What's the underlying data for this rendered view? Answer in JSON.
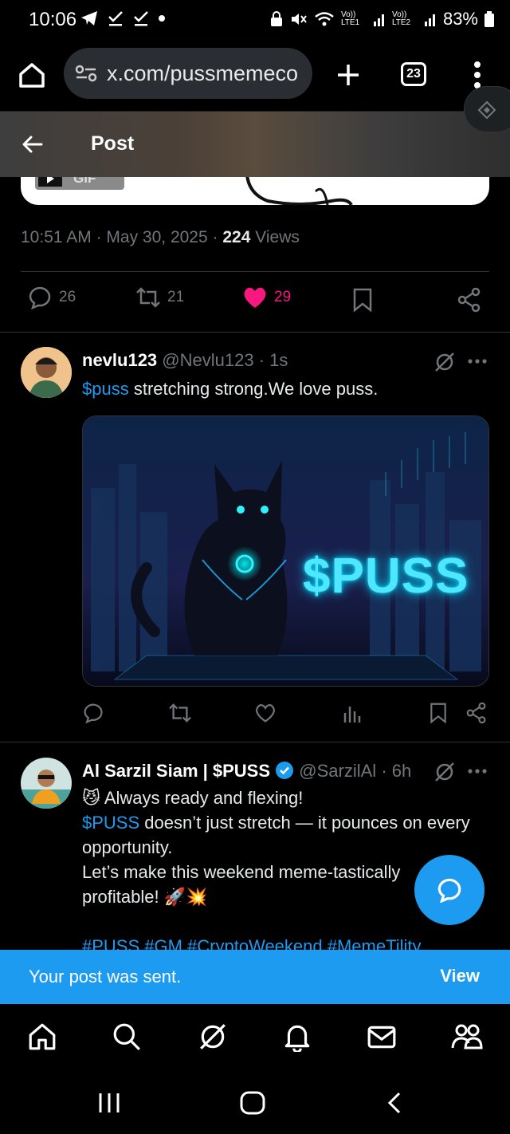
{
  "status_bar": {
    "time": "10:06",
    "network_1": "Vo)) LTE1",
    "network_2": "Vo)) LTE2",
    "battery": "83%"
  },
  "browser": {
    "url": "x.com/pussmemeco",
    "tab_count": "23"
  },
  "post_header": {
    "title": "Post"
  },
  "main_post": {
    "gif_label": "GIF",
    "time": "10:51 AM",
    "date": "May 30, 2025",
    "views_count": "224",
    "views_label": "Views",
    "replies": "26",
    "reposts": "21",
    "likes": "29",
    "like_color": "#f91880"
  },
  "reply_1": {
    "name": "nevlu123",
    "handle": "@Nevlu123",
    "time": "1s",
    "cashtag": "$puss",
    "text": " stretching strong.We love puss.",
    "media_text": "$PUSS"
  },
  "reply_2": {
    "name": "Al Sarzil Siam | $PUSS",
    "handle": "@SarzilAl",
    "time": "6h",
    "line1_emoji": "😼",
    "line1": " Always ready and flexing!",
    "cashtag": "$PUSS",
    "line2": " doesn’t just stretch — it pounces on every opportunity.",
    "line3": "Let’s make this weekend meme-tastically profitable! 🚀💥",
    "hashtags": "#PUSS #GM #CryptoWeekend #MemeTility"
  },
  "toast": {
    "message": "Your post was sent.",
    "action": "View"
  },
  "colors": {
    "accent": "#1d9bf0",
    "background": "#000000",
    "muted": "#71767b"
  }
}
